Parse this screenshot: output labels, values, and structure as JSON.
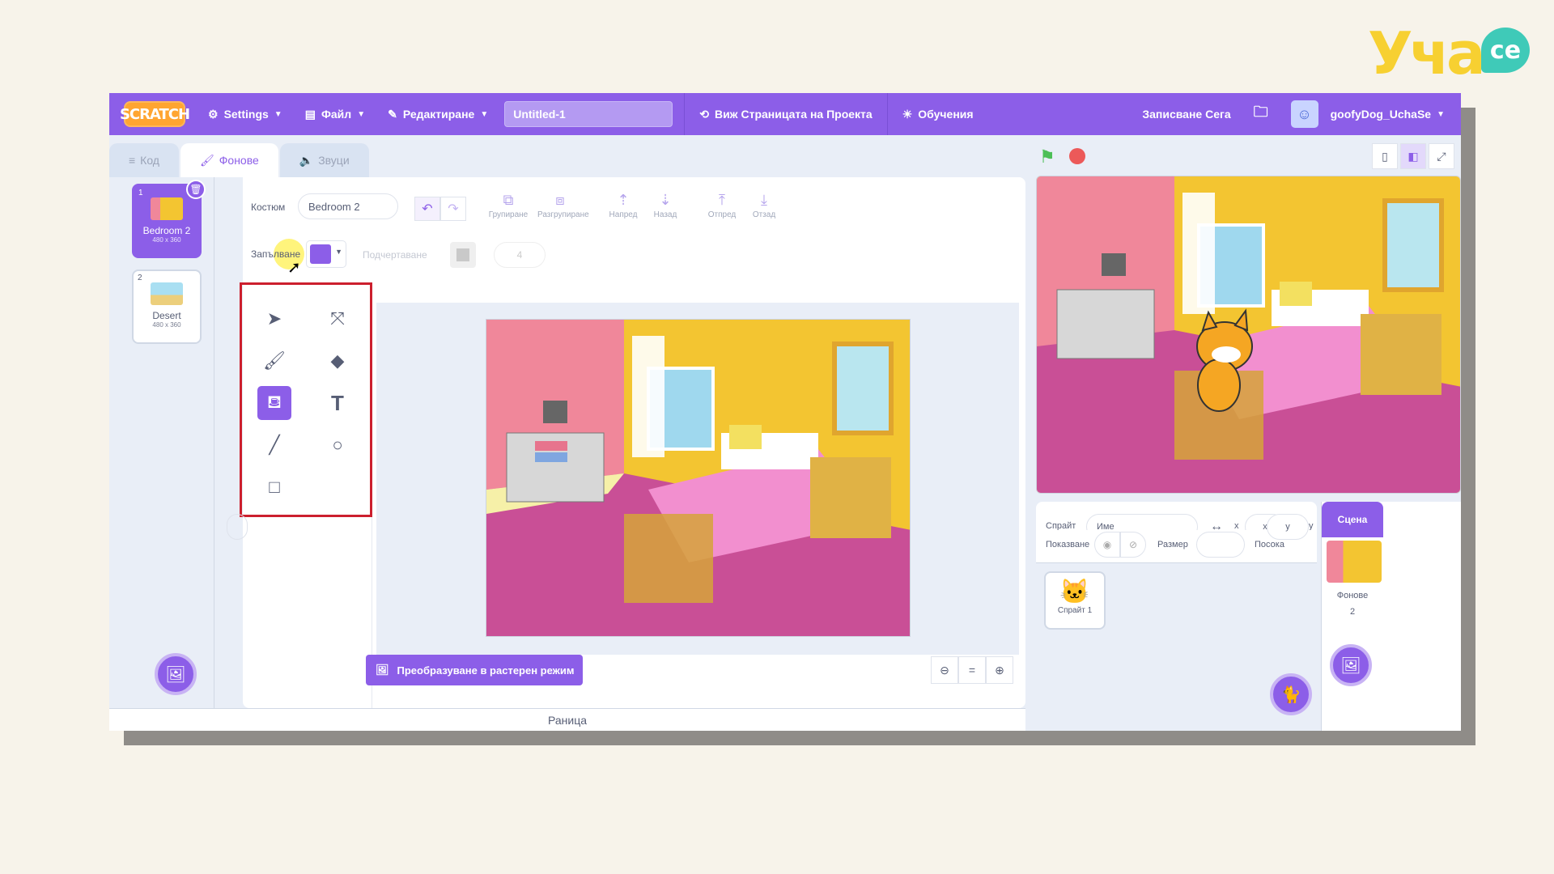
{
  "brand": {
    "main": "Уча",
    "badge": "се"
  },
  "menubar": {
    "logo": "SCRATCH",
    "settings": "Settings",
    "file": "Файл",
    "edit": "Редактиране",
    "project_title": "Untitled-1",
    "project_page": "Виж Страницата на Проекта",
    "tutorials": "Обучения",
    "save_now": "Записване Сега",
    "username": "goofyDog_UchaSe"
  },
  "tabs": [
    {
      "label": "Код",
      "icon": "code-icon"
    },
    {
      "label": "Фонове",
      "icon": "brush-icon"
    },
    {
      "label": "Звуци",
      "icon": "speaker-icon"
    }
  ],
  "costumes": [
    {
      "num": "1",
      "name": "Bedroom 2",
      "size": "480 x 360"
    },
    {
      "num": "2",
      "name": "Desert",
      "size": "480 x 360"
    }
  ],
  "paint": {
    "costume_label": "Костюм",
    "costume_name": "Bedroom 2",
    "fill_label": "Запълване",
    "outline_label": "Подчертаване",
    "outline_width": "4",
    "fill_color": "#8c5ee8",
    "buttons": {
      "group": "Групиране",
      "ungroup": "Разгрупиране",
      "forward": "Напред",
      "backward": "Назад",
      "front": "Отпред",
      "back": "Отзад"
    },
    "convert_raster": "Преобразуване в растерен режим",
    "zoom_reset": "="
  },
  "backpack": "Раница",
  "sprite_info": {
    "sprite_label": "Спрайт",
    "name_placeholder": "Име",
    "x_placeholder": "x",
    "y_placeholder": "y",
    "x_label": "x",
    "y_label": "y",
    "show_label": "Показване",
    "size_label": "Размер",
    "direction_label": "Посока"
  },
  "sprites": [
    {
      "name": "Спрайт 1"
    }
  ],
  "stage_pane": {
    "header": "Сцена",
    "backdrops_label": "Фонове",
    "backdrops_count": "2"
  },
  "colors": {
    "accent": "#8c5ee8",
    "tool_frame": "#cc1f2e",
    "flag": "#4cbf56",
    "stop": "#ec5959"
  }
}
